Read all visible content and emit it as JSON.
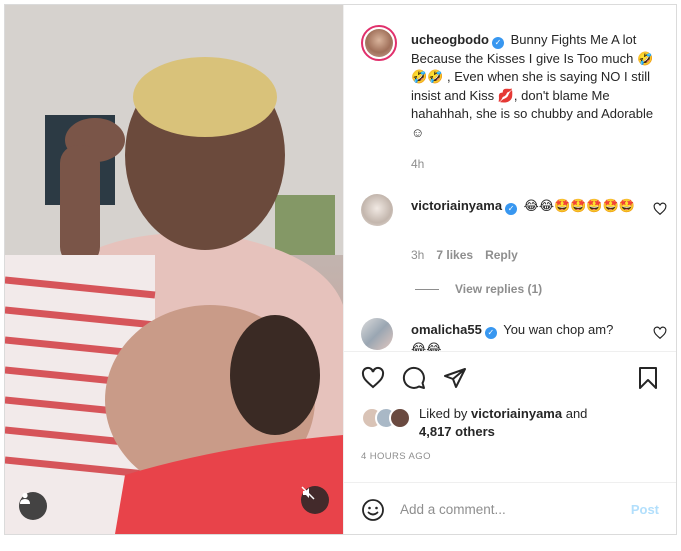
{
  "post": {
    "author": "ucheogbodo",
    "caption_text": "Bunny Fights Me A lot Because the Kisses I give Is Too much",
    "caption_emoji_1": "🤣",
    "caption_emoji_2": "🤣🤣",
    "caption_text_2": ", Even when she is saying NO I still insist and Kiss",
    "caption_emoji_3": "💋",
    "caption_text_3": ", don't blame Me hahahhah, she is so chubby and Adorable",
    "caption_emoji_4": "☺",
    "time_ago": "4h"
  },
  "comments": [
    {
      "username": "victoriainyama",
      "text": "😂😂🤩🤩🤩🤩🤩",
      "time": "3h",
      "likes": "7 likes",
      "reply_label": "Reply",
      "view_replies": "View replies (1)"
    },
    {
      "username": "omalicha55",
      "text": "You wan chop am?",
      "emoji": "😂😂"
    }
  ],
  "likes": {
    "prefix": "Liked by",
    "user": "victoriainyama",
    "conj": "and",
    "others": "4,817 others"
  },
  "timestamp": "4 HOURS AGO",
  "add_comment": {
    "placeholder": "Add a comment...",
    "post_label": "Post"
  },
  "colors": {
    "verified": "#3897f0",
    "post_disabled": "#b2dffc",
    "muted_text": "#8e8e8e"
  },
  "icons": [
    "heart-icon",
    "comment-icon",
    "share-icon",
    "bookmark-icon",
    "emoji-icon",
    "user-tag-icon",
    "mute-icon",
    "verified-badge"
  ]
}
